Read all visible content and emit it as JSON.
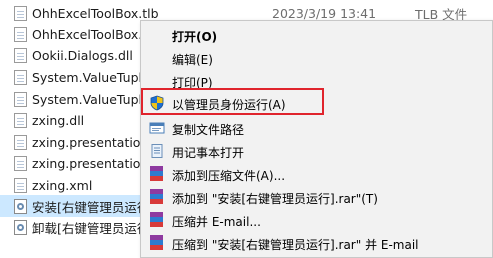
{
  "files": [
    {
      "name": "OhhExcelToolBox.tlb",
      "date": "2023/3/19 13:41",
      "type": "TLB 文件",
      "icon": "document-icon"
    },
    {
      "name": "OhhExcelToolBox.x",
      "date": "",
      "type": "",
      "icon": "document-icon"
    },
    {
      "name": "Ookii.Dialogs.dll",
      "date": "",
      "type": "",
      "icon": "document-icon"
    },
    {
      "name": "System.ValueTuple",
      "date": "",
      "type": "",
      "icon": "document-icon"
    },
    {
      "name": "System.ValueTuple",
      "date": "",
      "type": "",
      "icon": "document-icon"
    },
    {
      "name": "zxing.dll",
      "date": "",
      "type": "",
      "icon": "document-icon"
    },
    {
      "name": "zxing.presentation",
      "date": "",
      "type": "",
      "icon": "document-icon"
    },
    {
      "name": "zxing.presentation",
      "date": "",
      "type": "",
      "icon": "document-icon"
    },
    {
      "name": "zxing.xml",
      "date": "",
      "type": "",
      "icon": "document-icon"
    },
    {
      "name": "安装[右键管理员运行",
      "date": "",
      "type": "",
      "icon": "batch-file-icon",
      "selected": true
    },
    {
      "name": "卸载[右键管理员运行",
      "date": "",
      "type": "",
      "icon": "batch-file-icon"
    }
  ],
  "context_menu": {
    "items": [
      {
        "label": "打开(O)",
        "bold": true,
        "icon": ""
      },
      {
        "label": "编辑(E)",
        "icon": ""
      },
      {
        "label": "打印(P)",
        "icon": ""
      },
      {
        "label": "以管理员身份运行(A)",
        "icon": "uac-shield-icon",
        "highlighted": true
      },
      {
        "label": "复制文件路径",
        "icon": "copy-path-icon"
      },
      {
        "label": "用记事本打开",
        "icon": "notepad-icon"
      },
      {
        "label": "添加到压缩文件(A)...",
        "icon": "winrar-icon"
      },
      {
        "label": "添加到 \"安装[右键管理员运行].rar\"(T)",
        "icon": "winrar-icon"
      },
      {
        "label": "压缩并 E-mail...",
        "icon": "winrar-icon"
      },
      {
        "label": "压缩到 \"安装[右键管理员运行].rar\" 并 E-mail",
        "icon": "winrar-icon"
      }
    ]
  },
  "colors": {
    "selection": "#cce8ff",
    "highlight_border": "#e0242d",
    "menu_bg": "#f2f2f2"
  }
}
